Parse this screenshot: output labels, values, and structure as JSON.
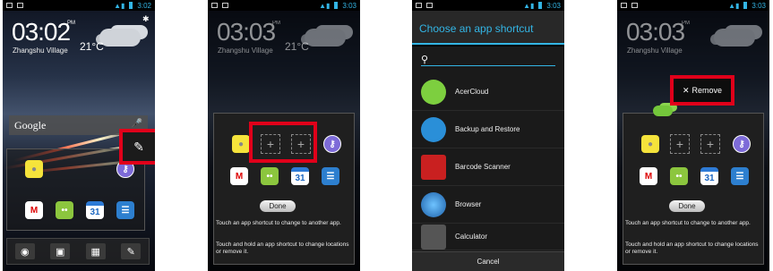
{
  "status": {
    "p1": "3:02",
    "p2": "3:03",
    "p3": "3:03",
    "p4": "3:03",
    "ampm": "PM"
  },
  "clock": {
    "p1": "03:02",
    "p2": "03:03",
    "p4": "03:03",
    "ampm": "PM"
  },
  "weather": {
    "temp": "21°C",
    "location": "Zhangshu Village"
  },
  "google_bar": "Google",
  "panel": {
    "done_label": "Done",
    "tip_change": "Touch an app shortcut to change to another app.",
    "tip_move": "Touch and hold an app shortcut to change locations or remove it."
  },
  "slot_plus": "+",
  "chooser": {
    "title": "Choose an app shortcut",
    "apps": [
      "AcerCloud",
      "Backup and Restore",
      "Barcode Scanner",
      "Browser",
      "Calculator"
    ],
    "cancel": "Cancel"
  },
  "remove_label": "Remove",
  "icons": {
    "gmail": "M",
    "calendar": "31",
    "android": "••",
    "camera": "◉",
    "calculator": "▦",
    "notes": "✎",
    "gallery": "▣"
  },
  "colors": {
    "highlight": "#e0001a",
    "accent": "#33b5e5"
  }
}
